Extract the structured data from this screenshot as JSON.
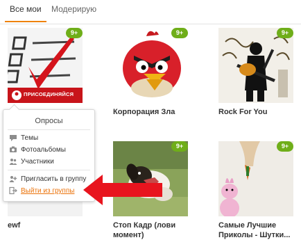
{
  "tabs": [
    {
      "label": "Все мои",
      "active": true
    },
    {
      "label": "Модерирую",
      "active": false
    }
  ],
  "groups": [
    {
      "title": "",
      "badge": "9+",
      "image": "checklist-logo",
      "logo_text": "ПРИСОЕДИНЯЙСЯ"
    },
    {
      "title": "Корпорация Зла",
      "badge": "9+",
      "image": "angry-bird"
    },
    {
      "title": "Rock For You",
      "badge": "9+",
      "image": "guitarist"
    },
    {
      "title": "ewf",
      "badge": "",
      "image": "blank"
    },
    {
      "title": "Стоп Кадр (лови момент)",
      "badge": "9+",
      "image": "dog"
    },
    {
      "title": "Самые Лучшие Приколы - Шутки...",
      "badge": "9+",
      "image": "bunny-carrot"
    }
  ],
  "popup_menu": {
    "title": "Опросы",
    "items": [
      {
        "label": "Темы",
        "icon": "chat-icon"
      },
      {
        "label": "Фотоальбомы",
        "icon": "camera-icon"
      },
      {
        "label": "Участники",
        "icon": "people-icon"
      }
    ],
    "invite_label": "Пригласить в группу",
    "invite_icon": "invite-icon",
    "leave_label": "Выйти из группы",
    "leave_icon": "exit-icon"
  },
  "colors": {
    "accent": "#ee8208",
    "badge": "#6fae19",
    "arrow": "#e8141e",
    "leave_link": "#eb7209"
  }
}
